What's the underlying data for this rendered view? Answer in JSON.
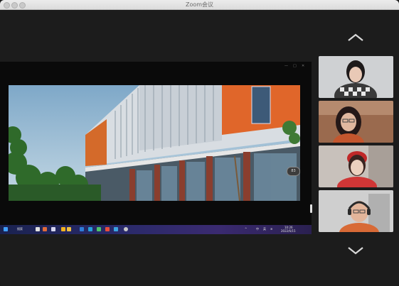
{
  "window": {
    "title": "Zoom会议"
  },
  "shared_screen": {
    "taskbar": {
      "search_label": "搜索",
      "clock_time": "10:26",
      "clock_date": "2022/6/15",
      "ime_label": "中",
      "tray_label": "英"
    },
    "badge_text": "83"
  },
  "participants": [
    {
      "id": "p1",
      "name": ""
    },
    {
      "id": "p2",
      "name": ""
    },
    {
      "id": "p3",
      "name": ""
    },
    {
      "id": "p4",
      "name": ""
    }
  ],
  "icons": {
    "scroll_up": "chevron-up-icon",
    "scroll_down": "chevron-down-icon"
  }
}
